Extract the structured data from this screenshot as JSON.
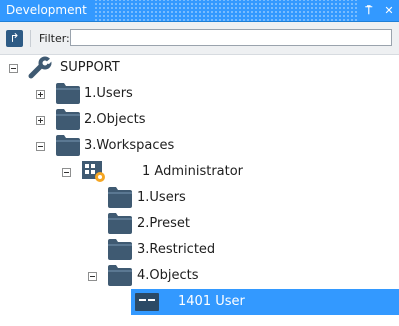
{
  "window": {
    "title": "Development",
    "pin_glyph": "⍑",
    "close_glyph": "✕"
  },
  "toolbar": {
    "expand_glyph": "↱",
    "filter_label": "Filter:",
    "filter_value": "",
    "filter_placeholder": ""
  },
  "tree": {
    "root": {
      "label": "SUPPORT",
      "icon": "wrench-icon",
      "expanded": true
    },
    "children": [
      {
        "label": "1.Users",
        "icon": "folder-icon",
        "expanded": false
      },
      {
        "label": "2.Objects",
        "icon": "folder-icon",
        "expanded": false
      },
      {
        "label": "3.Workspaces",
        "icon": "folder-icon",
        "expanded": true
      }
    ],
    "workspace": {
      "label": "1 Administrator",
      "icon": "workspace-icon",
      "expanded": true
    },
    "workspace_children": [
      {
        "label": "1.Users",
        "icon": "folder-icon"
      },
      {
        "label": "2.Preset",
        "icon": "folder-icon"
      },
      {
        "label": "3.Restricted",
        "icon": "folder-icon"
      },
      {
        "label": "4.Objects",
        "icon": "folder-icon",
        "expanded": true
      }
    ],
    "object": {
      "label": "1401 User",
      "icon": "object-icon",
      "selected": true
    }
  },
  "colors": {
    "accent": "#3399ff",
    "folder": "#3f5a72",
    "folder_light": "#5b7892"
  }
}
